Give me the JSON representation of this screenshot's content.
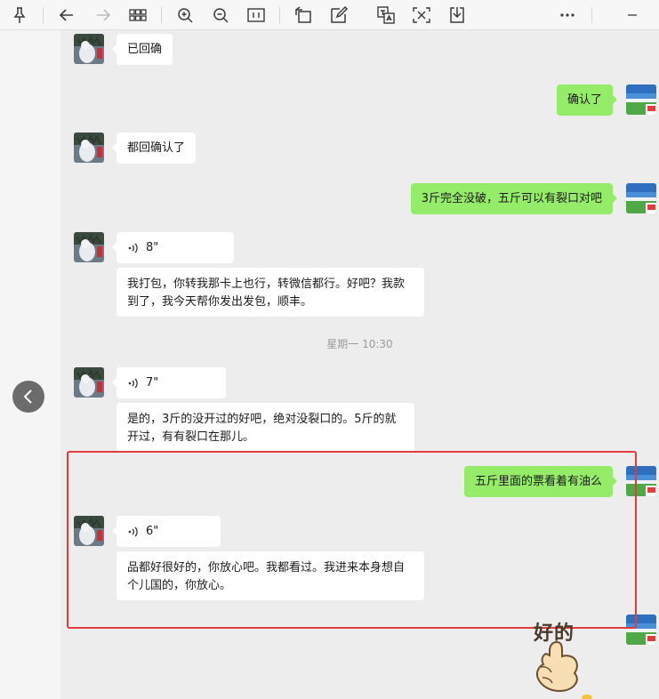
{
  "toolbar": {
    "icons": [
      "pin-icon",
      "back-arrow-icon",
      "forward-arrow-icon",
      "grid-icon",
      "zoom-in-icon",
      "zoom-out-icon",
      "fit-icon",
      "rotate-icon",
      "edit-icon",
      "translate-icon",
      "text-extract-icon",
      "download-icon",
      "more-icon",
      "minimize-icon"
    ]
  },
  "conversation": {
    "messages": [
      {
        "side": "in",
        "type": "text",
        "text": "已回确"
      },
      {
        "side": "out",
        "type": "text",
        "text": "确认了"
      },
      {
        "side": "in",
        "type": "text",
        "text": "都回确认了"
      },
      {
        "side": "out",
        "type": "text",
        "text": "3斤完全没破，五斤可以有裂口对吧"
      },
      {
        "side": "in",
        "type": "voice",
        "duration": "8\""
      },
      {
        "side": "in",
        "type": "text",
        "text": "我打包，你转我那卡上也行，转微信都行。好吧？我款到了，我今天帮你发出发包，顺丰。"
      },
      {
        "side": "in",
        "type": "voice",
        "duration": "7\""
      },
      {
        "side": "in",
        "type": "text",
        "text": "是的，3斤的没开过的好吧，绝对没裂口的。5斤的就开过，有有裂口在那儿。"
      },
      {
        "side": "out",
        "type": "text",
        "text": "五斤里面的票看着有油么"
      },
      {
        "side": "in",
        "type": "voice",
        "duration": "6\""
      },
      {
        "side": "in",
        "type": "text",
        "text": "品都好很好的，你放心吧。我都看过。我进来本身想自个儿国的，你放心。"
      },
      {
        "side": "out",
        "type": "sticker",
        "text": "好的"
      }
    ],
    "timestamp": "星期一 10:30"
  },
  "colors": {
    "outgoing_bubble": "#95ec69",
    "incoming_bubble": "#ffffff",
    "highlight_box": "#e23c3c",
    "background": "#ededed"
  }
}
